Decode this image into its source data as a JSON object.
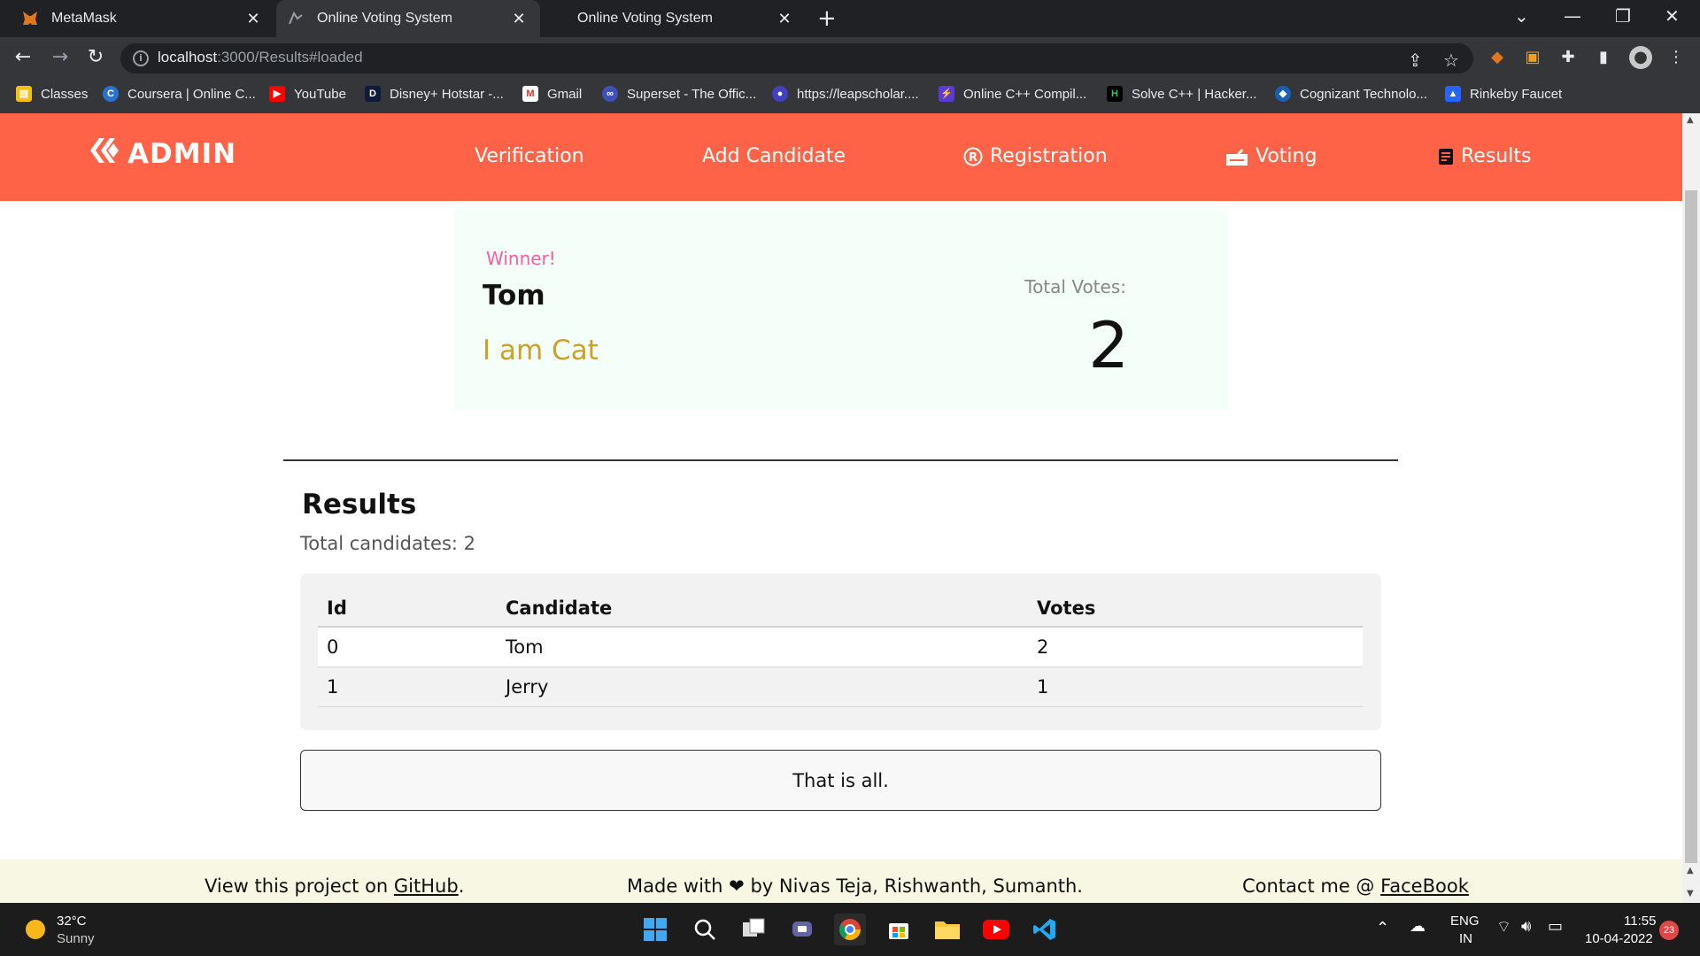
{
  "browser": {
    "tabs": [
      {
        "title": "MetaMask",
        "icon": "metamask-fox-icon"
      },
      {
        "title": "Online Voting System",
        "icon": "voting-favicon"
      },
      {
        "title": "Online Voting System",
        "icon": "none"
      }
    ],
    "url_host": "localhost",
    "url_path": ":3000/Results#loaded",
    "bookmarks": [
      "Classes",
      "Coursera | Online C...",
      "YouTube",
      "Disney+ Hotstar -...",
      "Gmail",
      "Superset - The Offic...",
      "https://leapscholar....",
      "Online C++ Compil...",
      "Solve C++ | Hacker...",
      "Cognizant Technolo...",
      "Rinkeby Faucet"
    ]
  },
  "navbar": {
    "brand": "ADMIN",
    "links": [
      "Verification",
      "Add Candidate",
      "Registration",
      "Voting",
      "Results"
    ],
    "bg_color": "#ff6347"
  },
  "winner": {
    "label": "Winner!",
    "name": "Tom",
    "description": "I am Cat",
    "votes_label": "Total Votes:",
    "votes": "2"
  },
  "results": {
    "title": "Results",
    "total_candidates": "Total candidates: 2",
    "columns": [
      "Id",
      "Candidate",
      "Votes"
    ],
    "rows": [
      [
        "0",
        "Tom",
        "2"
      ],
      [
        "1",
        "Jerry",
        "1"
      ]
    ],
    "end_text": "That is all."
  },
  "footer": {
    "github_prefix": "View this project on ",
    "github_link": "GitHub",
    "github_suffix": ".",
    "made_prefix": "Made with ",
    "made_suffix": " by Nivas Teja, Rishwanth, Sumanth.",
    "contact_prefix": "Contact me @ ",
    "contact_link": "FaceBook"
  },
  "taskbar": {
    "temp": "32°C",
    "weather": "Sunny",
    "lang1": "ENG",
    "lang2": "IN",
    "time": "11:55",
    "date": "10-04-2022",
    "notif_count": "23"
  }
}
